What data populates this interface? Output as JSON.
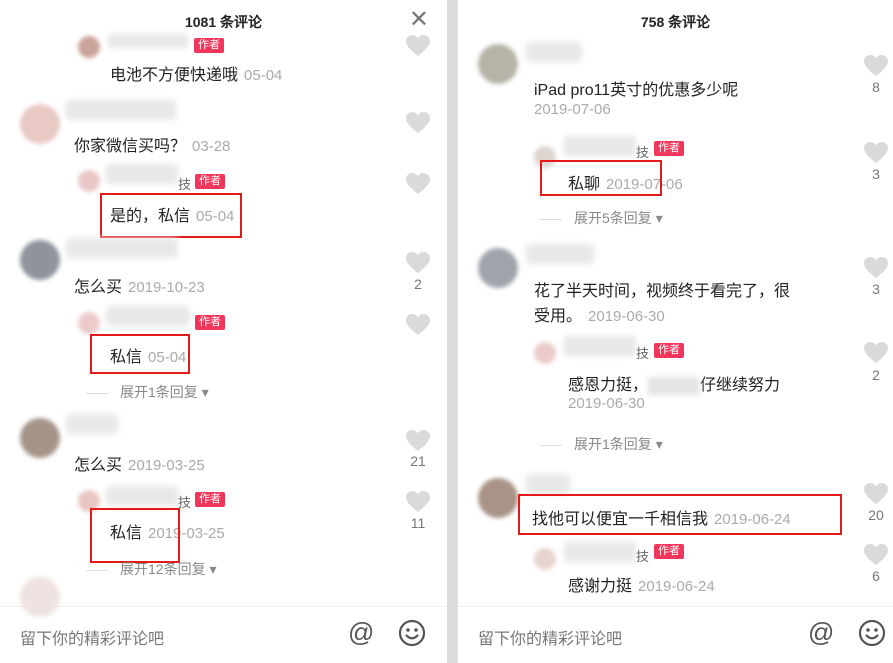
{
  "left": {
    "title": "1081 条评论",
    "close_label": "✕",
    "top_reply": {
      "text": "电池不方便快递哦",
      "date": "05-04"
    },
    "c1": {
      "text": "你家微信买吗？",
      "date": "03-28"
    },
    "c1_reply": {
      "name_tail": "技",
      "badge": "作者",
      "text": "是的，私信",
      "date": "05-04"
    },
    "c2": {
      "text": "怎么买",
      "date": "2019-10-23",
      "likes": "2"
    },
    "c2_reply": {
      "badge": "作者",
      "text": "私信",
      "date": "05-04",
      "expand": "展开1条回复"
    },
    "c3": {
      "text": "怎么买",
      "date": "2019-03-25",
      "likes": "21"
    },
    "c3_reply": {
      "name_tail": "技",
      "badge": "作者",
      "text": "私信",
      "date": "2019-03-25",
      "likes": "11",
      "expand": "展开12条回复"
    },
    "input_placeholder": "留下你的精彩评论吧"
  },
  "right": {
    "title": "758 条评论",
    "c1": {
      "text": "iPad pro11英寸的优惠多少呢",
      "date": "2019-07-06",
      "likes": "8"
    },
    "c1_reply": {
      "name_tail": "技",
      "badge": "作者",
      "text": "私聊",
      "date": "2019-07-06",
      "likes": "3",
      "expand": "展开5条回复"
    },
    "c2": {
      "text_line1": "花了半天时间，视频终于看完了，很",
      "text_line2": "受用。",
      "date": "2019-06-30",
      "likes": "3"
    },
    "c2_reply": {
      "name_tail": "技",
      "badge": "作者",
      "text_a": "感恩力挺，",
      "text_b": "仔继续努力",
      "date": "2019-06-30",
      "likes": "2",
      "expand": "展开1条回复"
    },
    "c3": {
      "text": "找他可以便宜一千相信我",
      "date": "2019-06-24",
      "likes": "20"
    },
    "c3_reply": {
      "name_tail": "技",
      "badge": "作者",
      "text": "感谢力挺",
      "date": "2019-06-24",
      "likes": "6"
    },
    "input_placeholder": "留下你的精彩评论吧"
  },
  "colors": {
    "author_badge": "#f2365b",
    "highlight_box": "#e31a1a"
  },
  "icons": {
    "like": "heart-icon",
    "mention": "at-icon",
    "emoji": "emoji-icon",
    "close": "close-icon",
    "expand": "chevron-down-icon"
  }
}
